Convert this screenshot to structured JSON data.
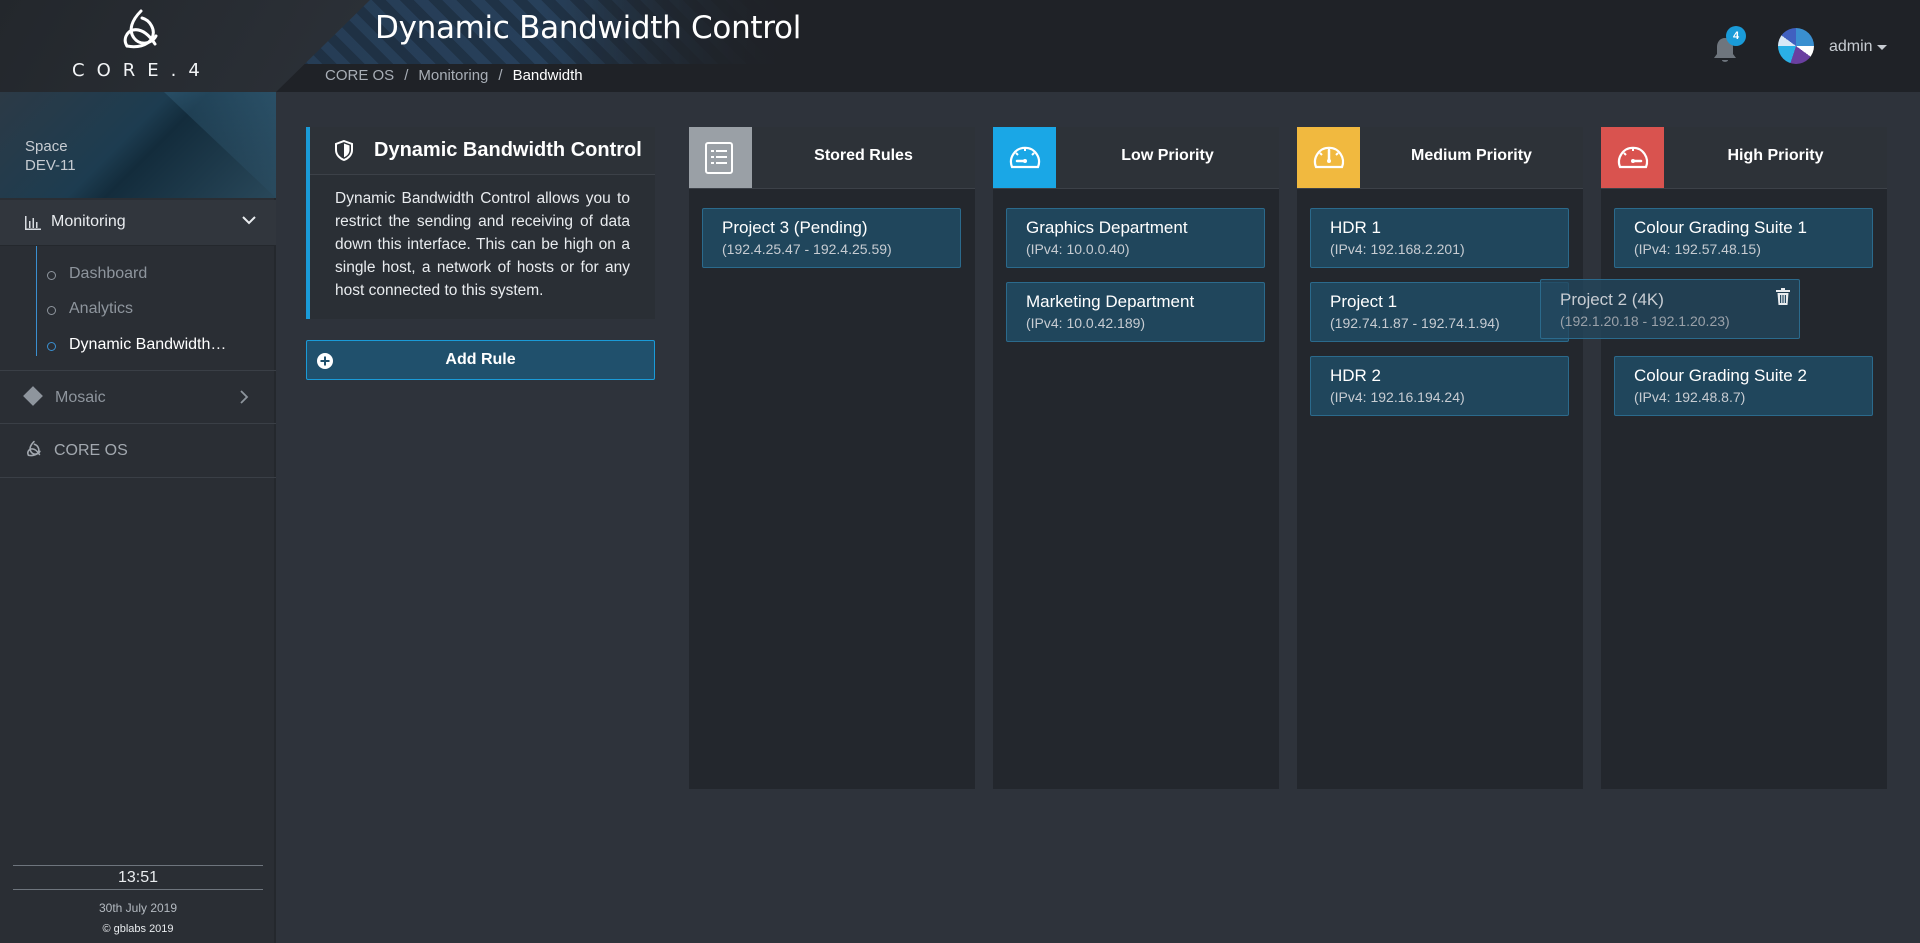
{
  "brand": {
    "name": "CORE.4"
  },
  "header": {
    "title": "Dynamic Bandwidth Control",
    "breadcrumb": [
      "CORE OS",
      "Monitoring",
      "Bandwidth"
    ],
    "notifications_count": "4",
    "user": "admin"
  },
  "sidebar": {
    "space_label": "Space",
    "space_value": "DEV-11",
    "monitoring": "Monitoring",
    "subitems": [
      "Dashboard",
      "Analytics",
      "Dynamic Bandwidth…"
    ],
    "mosaic": "Mosaic",
    "coreos": "CORE OS",
    "time": "13:51",
    "date": "30th July 2019",
    "copyright": "© gblabs 2019"
  },
  "info": {
    "title": "Dynamic Bandwidth Control",
    "description": "Dynamic Bandwidth Control allows you to restrict the sending and receiving of data down this interface. This can be high on a single host, a network of hosts or for any host connected to this system.",
    "add_rule": "Add Rule"
  },
  "columns": [
    {
      "title": "Stored Rules",
      "color": "#9aa0a6",
      "icon": "list-icon",
      "rules": [
        {
          "name": "Project 3 (Pending)",
          "addr": "(192.4.25.47 - 192.4.25.59)"
        }
      ]
    },
    {
      "title": "Low Priority",
      "color": "#1aa7e6",
      "icon": "speedometer-icon",
      "rules": [
        {
          "name": "Graphics Department",
          "addr": "(IPv4: 10.0.0.40)"
        },
        {
          "name": "Marketing Department",
          "addr": "(IPv4: 10.0.42.189)"
        }
      ]
    },
    {
      "title": "Medium Priority",
      "color": "#f1b93f",
      "icon": "speedometer-icon",
      "rules": [
        {
          "name": "HDR 1",
          "addr": "(IPv4: 192.168.2.201)"
        },
        {
          "name": "Project 1",
          "addr": "(192.74.1.87 - 192.74.1.94)"
        },
        {
          "name": "HDR 2",
          "addr": "(IPv4: 192.16.194.24)"
        }
      ]
    },
    {
      "title": "High Priority",
      "color": "#d9534f",
      "icon": "speedometer-icon",
      "rules": [
        {
          "name": "Colour Grading Suite 1",
          "addr": "(IPv4: 192.57.48.15)"
        },
        {
          "name": "Colour Grading Suite 2",
          "addr": "(IPv4: 192.48.8.7)"
        }
      ]
    }
  ],
  "dragging": {
    "name": "Project 2 (4K)",
    "addr": "(192.1.20.18 - 192.1.20.23)"
  }
}
